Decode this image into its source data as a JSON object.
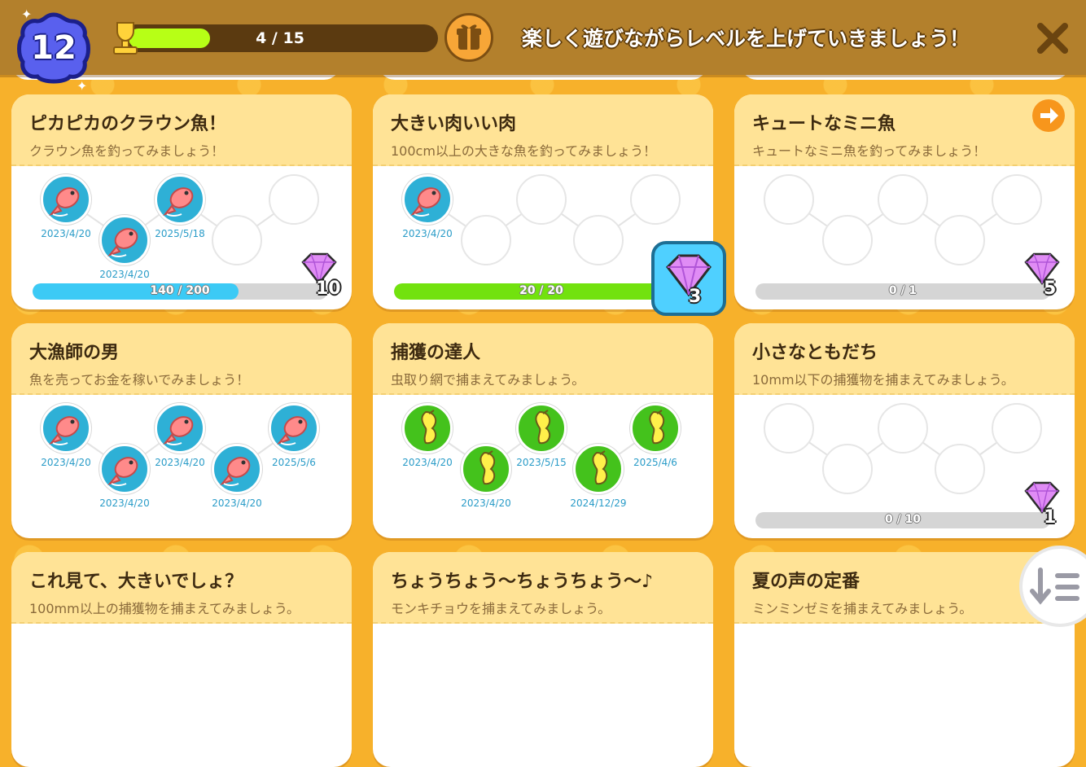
{
  "header": {
    "level": "12",
    "xp_text": "4 / 15",
    "xp_progress": 0.27,
    "message": "楽しく遊びながらレベルを上げていきましょう！",
    "icons": [
      "trophy-icon",
      "gift-icon",
      "close-icon"
    ]
  },
  "cards": [
    {
      "title": "ピカピカのクラウン魚！",
      "desc": "クラウン魚を釣ってみましょう！",
      "slots": [
        {
          "kind": "fish",
          "date": "2023/4/20"
        },
        {
          "kind": "fish",
          "date": "2023/4/20"
        },
        {
          "kind": "fish",
          "date": "2025/5/18"
        },
        {
          "kind": "empty",
          "date": ""
        },
        {
          "kind": "empty",
          "date": ""
        }
      ],
      "progress_text": "140 / 200",
      "progress": 0.7,
      "bar_color": "#3ccaf5",
      "reward": "10"
    },
    {
      "title": "大きい肉いい肉",
      "desc": "100cm以上の大きな魚を釣ってみましょう！",
      "slots": [
        {
          "kind": "fish",
          "date": "2023/4/20"
        },
        {
          "kind": "empty",
          "date": ""
        },
        {
          "kind": "empty",
          "date": ""
        },
        {
          "kind": "empty",
          "date": ""
        },
        {
          "kind": "empty",
          "date": ""
        }
      ],
      "progress_text": "20 / 20",
      "progress": 1.0,
      "bar_color": "#72e20e",
      "reward": "3"
    },
    {
      "title": "キュートなミニ魚",
      "desc": "キュートなミニ魚を釣ってみましょう！",
      "slots": [
        {
          "kind": "empty",
          "date": ""
        },
        {
          "kind": "empty",
          "date": ""
        },
        {
          "kind": "empty",
          "date": ""
        },
        {
          "kind": "empty",
          "date": ""
        },
        {
          "kind": "empty",
          "date": ""
        }
      ],
      "progress_text": "0 / 1",
      "progress": 0,
      "bar_color": "#3ccaf5",
      "reward": "5"
    },
    {
      "title": "大漁師の男",
      "desc": "魚を売ってお金を稼いでみましょう！",
      "slots": [
        {
          "kind": "fish",
          "date": "2023/4/20"
        },
        {
          "kind": "fish",
          "date": "2023/4/20"
        },
        {
          "kind": "fish",
          "date": "2023/4/20"
        },
        {
          "kind": "fish",
          "date": "2023/4/20"
        },
        {
          "kind": "fish",
          "date": "2025/5/6"
        }
      ],
      "progress_text": "",
      "progress": null,
      "bar_color": "",
      "reward": ""
    },
    {
      "title": "捕獲の達人",
      "desc": "虫取り網で捕まえてみましょう。",
      "slots": [
        {
          "kind": "bug",
          "date": "2023/4/20"
        },
        {
          "kind": "bug",
          "date": "2023/4/20"
        },
        {
          "kind": "bug",
          "date": "2023/5/15"
        },
        {
          "kind": "bug",
          "date": "2024/12/29"
        },
        {
          "kind": "bug",
          "date": "2025/4/6"
        }
      ],
      "progress_text": "",
      "progress": null,
      "bar_color": "",
      "reward": ""
    },
    {
      "title": "小さなともだち",
      "desc": "10mm以下の捕獲物を捕まえてみましょう。",
      "slots": [
        {
          "kind": "empty",
          "date": ""
        },
        {
          "kind": "empty",
          "date": ""
        },
        {
          "kind": "empty",
          "date": ""
        },
        {
          "kind": "empty",
          "date": ""
        },
        {
          "kind": "empty",
          "date": ""
        }
      ],
      "progress_text": "0 / 10",
      "progress": 0,
      "bar_color": "#3ccaf5",
      "reward": "1"
    },
    {
      "title": "これ見て、大きいでしょ？",
      "desc": "100mm以上の捕獲物を捕まえてみましょう。"
    },
    {
      "title": "ちょうちょう～ちょうちょう～♪",
      "desc": "モンキチョウを捕まえてみましょう。"
    },
    {
      "title": "夏の声の定番",
      "desc": "ミンミンゼミを捕まえてみましょう。"
    }
  ],
  "controls": {
    "next_icon": "arrow-right-icon",
    "sort_icon": "sort-icon"
  }
}
